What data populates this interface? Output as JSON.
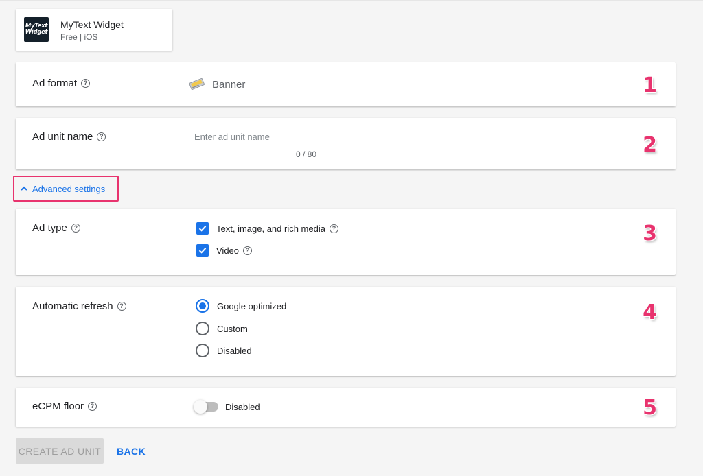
{
  "app": {
    "icon_line1": "MyText",
    "icon_line2": "Widget",
    "name": "MyText Widget",
    "meta": "Free | iOS"
  },
  "ad_format": {
    "label": "Ad format",
    "value": "Banner",
    "step": "1"
  },
  "ad_unit_name": {
    "label": "Ad unit name",
    "placeholder": "Enter ad unit name",
    "value": "",
    "char_count": "0 / 80",
    "step": "2"
  },
  "advanced_settings": {
    "label": "Advanced settings",
    "expanded": true
  },
  "ad_type": {
    "label": "Ad type",
    "step": "3",
    "options": [
      {
        "label": "Text, image, and rich media",
        "checked": true
      },
      {
        "label": "Video",
        "checked": true
      }
    ]
  },
  "automatic_refresh": {
    "label": "Automatic refresh",
    "step": "4",
    "options": [
      {
        "label": "Google optimized",
        "selected": true
      },
      {
        "label": "Custom",
        "selected": false
      },
      {
        "label": "Disabled",
        "selected": false
      }
    ]
  },
  "ecpm_floor": {
    "label": "eCPM floor",
    "toggle_label": "Disabled",
    "enabled": false,
    "step": "5"
  },
  "footer": {
    "create_label": "CREATE AD UNIT",
    "back_label": "BACK"
  },
  "colors": {
    "accent": "#1a73e8",
    "annotation": "#e8336e",
    "page_bg": "#f5f5f5"
  }
}
